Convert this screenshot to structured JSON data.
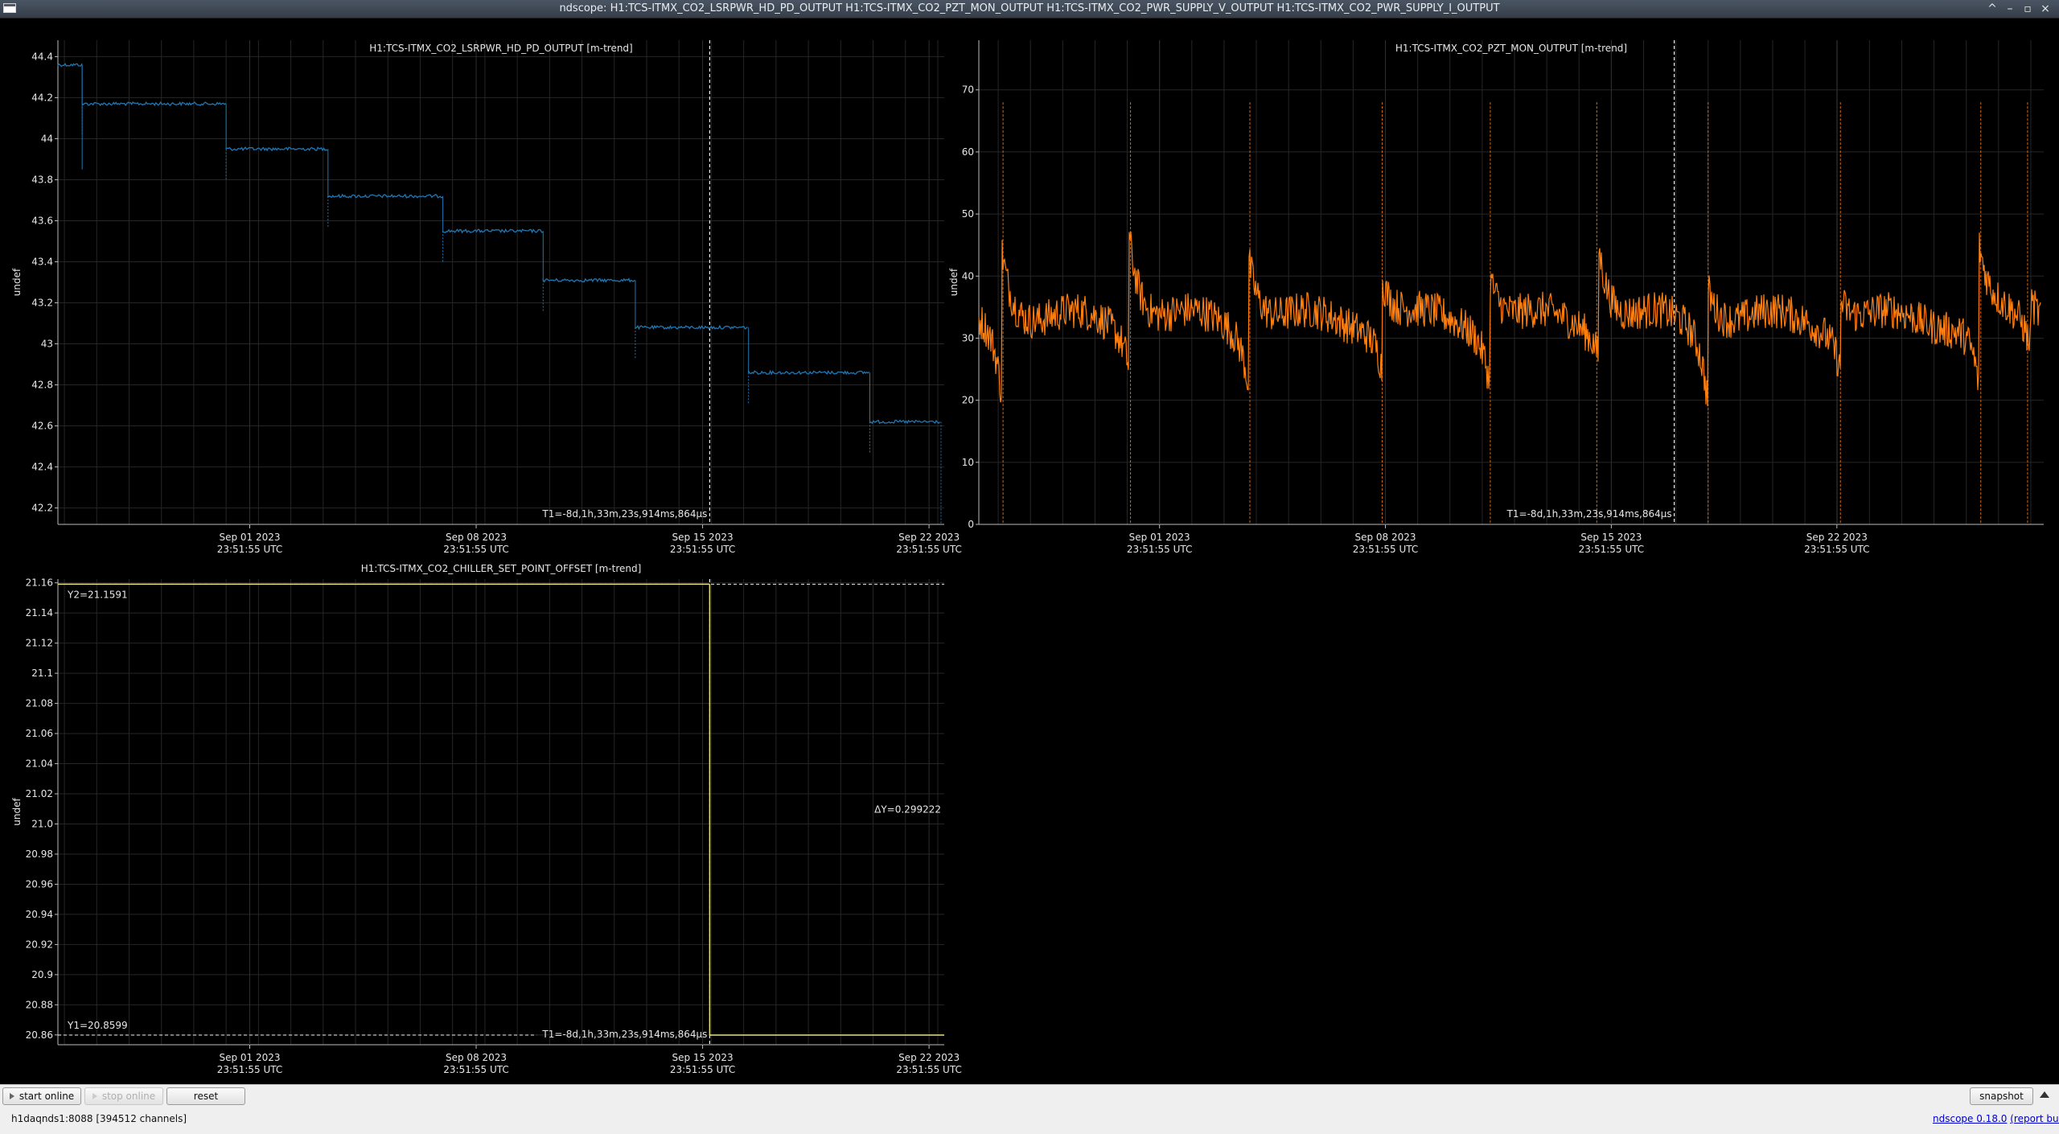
{
  "window": {
    "title": "ndscope: H1:TCS-ITMX_CO2_LSRPWR_HD_PD_OUTPUT H1:TCS-ITMX_CO2_PZT_MON_OUTPUT H1:TCS-ITMX_CO2_PWR_SUPPLY_V_OUTPUT H1:TCS-ITMX_CO2_PWR_SUPPLY_I_OUTPUT",
    "controls": [
      "^",
      "–",
      "▫",
      "×"
    ]
  },
  "x_ticks": [
    {
      "line1": "Sep 01 2023",
      "line2": "23:51:55 UTC"
    },
    {
      "line1": "Sep 08 2023",
      "line2": "23:51:55 UTC"
    },
    {
      "line1": "Sep 15 2023",
      "line2": "23:51:55 UTC"
    },
    {
      "line1": "Sep 22 2023",
      "line2": "23:51:55 UTC"
    }
  ],
  "cursor_label": "T1=-8d,1h,33m,23s,914ms,864µs",
  "y_label": "undef",
  "chart_data": [
    {
      "type": "line",
      "title": "H1:TCS-ITMX_CO2_LSRPWR_HD_PD_OUTPUT [m-trend]",
      "ylabel": "undef",
      "x_unit": "days relative to Sep 01 2023 23:51:55 UTC",
      "xlim": [
        -6.2,
        21.2
      ],
      "ylim": [
        42.12,
        44.48
      ],
      "y_ticks": [
        "44.4",
        "44.2",
        "44",
        "43.8",
        "43.6",
        "43.4",
        "43.2",
        "43",
        "42.8",
        "42.6",
        "42.4",
        "42.2"
      ],
      "color": "#1f77b4",
      "style": "steps",
      "steps": [
        {
          "x0": -6.2,
          "x1": -5.45,
          "y": 44.36
        },
        {
          "x0": -5.45,
          "x1": -1.0,
          "y": 44.17
        },
        {
          "x0": -1.0,
          "x1": 2.15,
          "y": 43.95
        },
        {
          "x0": 2.15,
          "x1": 5.7,
          "y": 43.72
        },
        {
          "x0": 5.7,
          "x1": 8.8,
          "y": 43.55
        },
        {
          "x0": 8.8,
          "x1": 11.65,
          "y": 43.31
        },
        {
          "x0": 11.65,
          "x1": 15.15,
          "y": 43.08
        },
        {
          "x0": 15.15,
          "x1": 18.9,
          "y": 42.86
        },
        {
          "x0": 18.9,
          "x1": 21.1,
          "y": 42.62
        }
      ],
      "cursor_x": 13.95
    },
    {
      "type": "line",
      "title": "H1:TCS-ITMX_CO2_PZT_MON_OUTPUT [m-trend]",
      "ylabel": "undef",
      "x_unit": "days relative to Sep 01 2023 23:51:55 UTC",
      "xlim": [
        -5.6,
        27.4
      ],
      "ylim": [
        0,
        78
      ],
      "y_ticks": [
        "70",
        "60",
        "50",
        "40",
        "30",
        "20",
        "10",
        "0"
      ],
      "color": "#ff7f0e",
      "baseline": 33,
      "spikes": [
        {
          "x": -4.9,
          "peak": 47,
          "dip": 21
        },
        {
          "x": -0.95,
          "peak": 50,
          "dip": 26
        },
        {
          "x": 2.75,
          "peak": 46,
          "dip": 23
        },
        {
          "x": 6.9,
          "peak": 41,
          "dip": 25
        },
        {
          "x": 10.25,
          "peak": 42,
          "dip": 22
        },
        {
          "x": 13.6,
          "peak": 48,
          "dip": 28
        },
        {
          "x": 17.0,
          "peak": 40,
          "dip": 19
        },
        {
          "x": 21.1,
          "peak": 38,
          "dip": 25
        },
        {
          "x": 25.4,
          "peak": 46,
          "dip": 20
        },
        {
          "x": 27.0,
          "peak": 36,
          "dip": 27
        }
      ],
      "min_max_marks": [
        {
          "x": -4.85,
          "max": 68,
          "min": 0
        },
        {
          "x": -0.9,
          "max": 68,
          "min": 0
        },
        {
          "x": 2.8,
          "max": 68,
          "min": 0
        },
        {
          "x": 6.9,
          "max": 68,
          "min": 0
        },
        {
          "x": 10.25,
          "max": 68,
          "min": 0
        },
        {
          "x": 13.55,
          "max": 68,
          "min": 0
        },
        {
          "x": 17.0,
          "max": 68,
          "min": 0
        },
        {
          "x": 21.1,
          "max": 68,
          "min": 0
        },
        {
          "x": 25.45,
          "max": 68,
          "min": 0
        },
        {
          "x": 26.9,
          "max": 68,
          "min": 0
        }
      ],
      "cursor_x": 15.95
    },
    {
      "type": "line",
      "title": "H1:TCS-ITMX_CO2_CHILLER_SET_POINT_OFFSET [m-trend]",
      "ylabel": "undef",
      "x_unit": "days relative to Sep 01 2023 23:51:55 UTC",
      "xlim": [
        -6.2,
        21.2
      ],
      "ylim": [
        20.8535,
        21.1625
      ],
      "y_ticks": [
        "21.16",
        "21.14",
        "21.12",
        "21.1",
        "21.08",
        "21.06",
        "21.04",
        "21.02",
        "21.0",
        "20.98",
        "20.96",
        "20.94",
        "20.92",
        "20.9",
        "20.88",
        "20.86"
      ],
      "color": "#e8e080",
      "segments": [
        {
          "x0": -6.2,
          "x1": 13.95,
          "y": 21.1591
        },
        {
          "x0": 13.95,
          "x1": 21.2,
          "y": 20.8599
        }
      ],
      "cursor_x": 13.95,
      "y1_label": "Y1=20.8599",
      "y2_label": "Y2=21.1591",
      "dy_label": "ΔY=0.299222",
      "y1": 20.8599,
      "y2": 21.1591
    }
  ],
  "bottom": {
    "start_label": "start online",
    "stop_label": "stop online",
    "reset_label": "reset",
    "snapshot_label": "snapshot",
    "server": "h1daqnds1:8088  [394512 channels]",
    "version": "ndscope 0.18.0",
    "report": "(report bug)"
  }
}
